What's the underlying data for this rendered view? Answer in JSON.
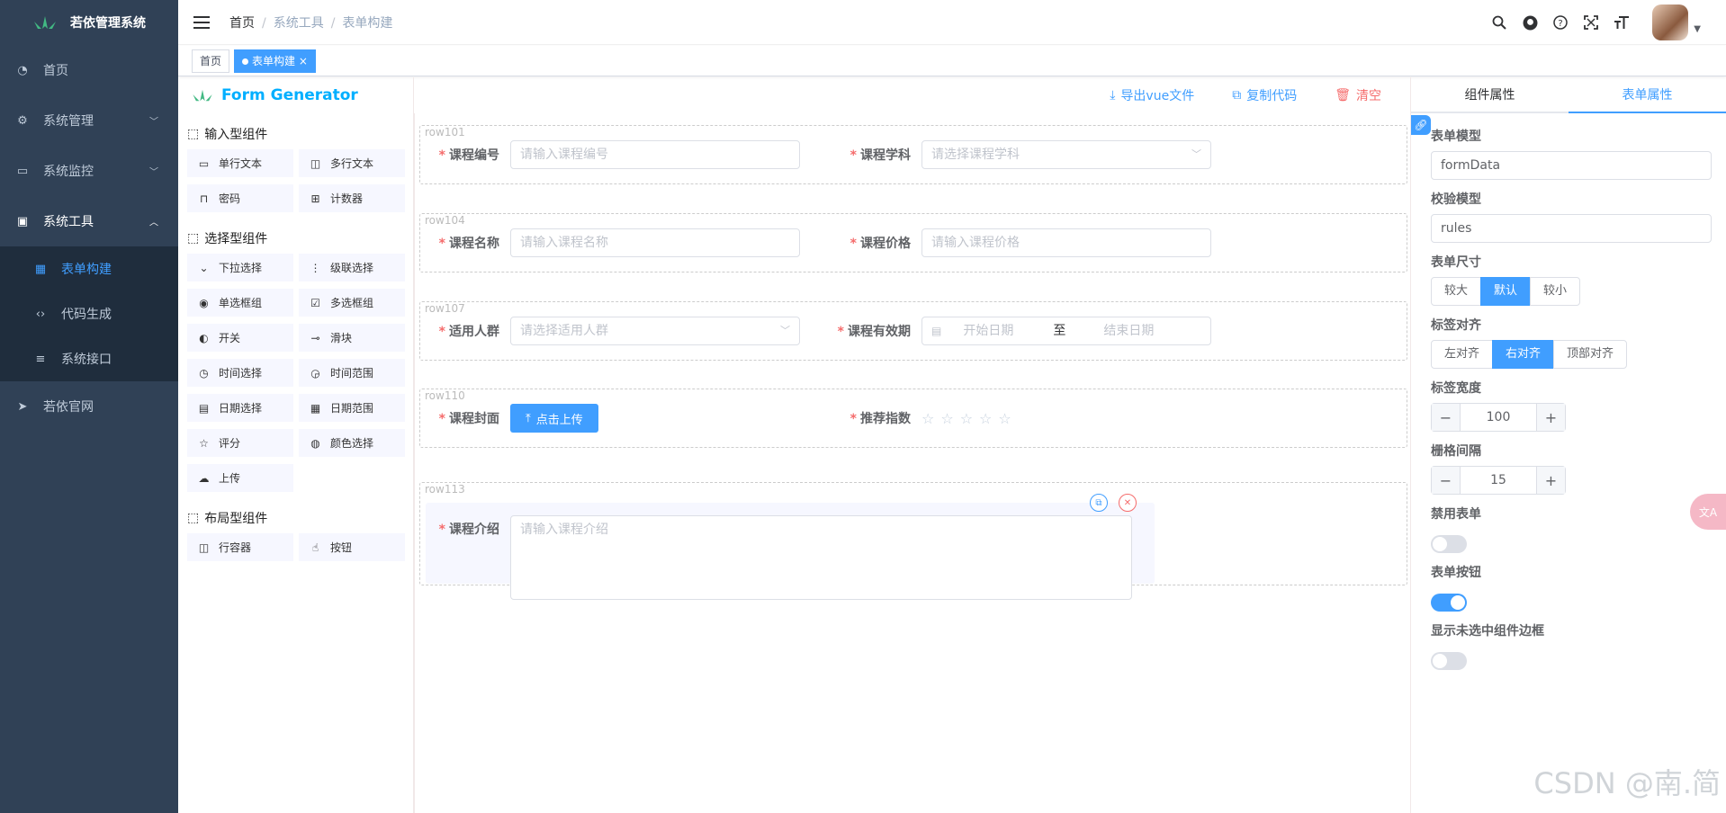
{
  "sidebar": {
    "logo_title": "若依管理系统",
    "items": [
      {
        "label": "首页"
      },
      {
        "label": "系统管理"
      },
      {
        "label": "系统监控"
      },
      {
        "label": "系统工具"
      },
      {
        "label": "若依官网"
      }
    ],
    "sub_items": [
      {
        "label": "表单构建"
      },
      {
        "label": "代码生成"
      },
      {
        "label": "系统接口"
      }
    ]
  },
  "navbar": {
    "breadcrumb": [
      "首页",
      "系统工具",
      "表单构建"
    ],
    "sep": "/"
  },
  "tags": [
    "首页",
    "表单构建"
  ],
  "tag_close": "×",
  "left_panel": {
    "logo_text": "Form Generator",
    "input_title": "输入型组件",
    "input_items": [
      "单行文本",
      "多行文本",
      "密码",
      "计数器"
    ],
    "select_title": "选择型组件",
    "select_items": [
      "下拉选择",
      "级联选择",
      "单选框组",
      "多选框组",
      "开关",
      "滑块",
      "时间选择",
      "时间范围",
      "日期选择",
      "日期范围",
      "评分",
      "颜色选择",
      "上传"
    ],
    "layout_title": "布局型组件",
    "layout_items": [
      "行容器",
      "按钮"
    ]
  },
  "toolbar": {
    "export": "导出vue文件",
    "copy": "复制代码",
    "clear": "清空"
  },
  "form": {
    "row1": "row101",
    "row2": "row104",
    "row3": "row107",
    "row4": "row110",
    "row5": "row113",
    "course_no_label": "课程编号",
    "course_no_placeholder": "请输入课程编号",
    "subject_label": "课程学科",
    "subject_placeholder": "请选择课程学科",
    "name_label": "课程名称",
    "name_placeholder": "请输入课程名称",
    "price_label": "课程价格",
    "price_placeholder": "请输入课程价格",
    "audience_label": "适用人群",
    "audience_placeholder": "请选择适用人群",
    "validity_label": "课程有效期",
    "start_placeholder": "开始日期",
    "range_sep": "至",
    "end_placeholder": "结束日期",
    "cover_label": "课程封面",
    "upload_label": "点击上传",
    "rating_label": "推荐指数",
    "rating_value": 0,
    "intro_label": "课程介绍",
    "intro_placeholder": "请输入课程介绍"
  },
  "right_panel": {
    "tab_component": "组件属性",
    "tab_form": "表单属性",
    "model_label": "表单模型",
    "model_value": "formData",
    "rules_label": "校验模型",
    "rules_value": "rules",
    "size_label": "表单尺寸",
    "size_options": [
      "较大",
      "默认",
      "较小"
    ],
    "size_selected": "默认",
    "align_label": "标签对齐",
    "align_options": [
      "左对齐",
      "右对齐",
      "顶部对齐"
    ],
    "align_selected": "右对齐",
    "label_width_label": "标签宽度",
    "label_width": "100",
    "gutter_label": "栅格间隔",
    "gutter": "15",
    "disabled_label": "禁用表单",
    "disabled": false,
    "btns_label": "表单按钮",
    "btns": true,
    "border_label": "显示未选中组件边框",
    "border": false
  },
  "watermark": "CSDN @南.简",
  "colors": {
    "primary": "#409eff",
    "sidebar": "#304156",
    "danger": "#f56c6c"
  }
}
